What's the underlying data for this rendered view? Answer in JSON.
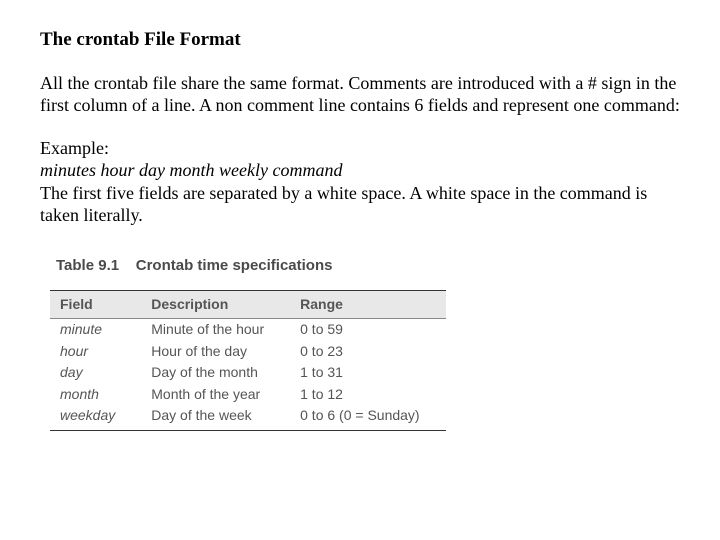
{
  "title": "The crontab File Format",
  "para1": "All the crontab file share the same format. Comments are introduced with a # sign in the first column of a line.  A non comment line contains 6 fields and represent one command:",
  "exampleLabel": "Example:",
  "formatLine": "minutes hour day month weekly command",
  "para2": "The first five fields are separated by a white space.  A white space in the command is taken literally.",
  "table": {
    "number": "Table 9.1",
    "caption": "Crontab time specifications",
    "headers": {
      "field": "Field",
      "desc": "Description",
      "range": "Range"
    },
    "rows": [
      {
        "field": "minute",
        "desc": "Minute of the hour",
        "range": "0 to 59"
      },
      {
        "field": "hour",
        "desc": "Hour of the day",
        "range": "0 to 23"
      },
      {
        "field": "day",
        "desc": "Day of the month",
        "range": "1 to 31"
      },
      {
        "field": "month",
        "desc": "Month of the year",
        "range": "1 to 12"
      },
      {
        "field": "weekday",
        "desc": "Day of the week",
        "range": "0 to 6 (0 = Sunday)"
      }
    ]
  }
}
